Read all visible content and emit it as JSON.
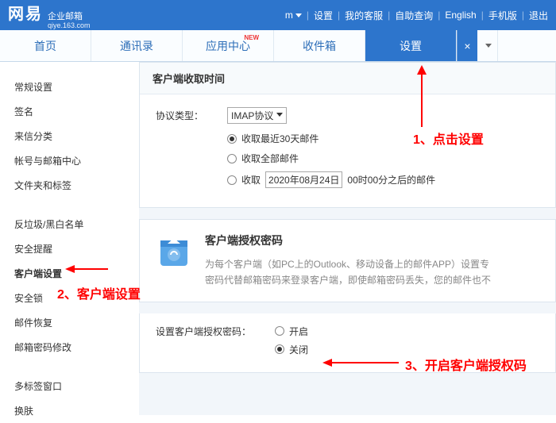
{
  "header": {
    "logo_main": "网易",
    "logo_sub": "企业邮箱",
    "logo_domain": "qiye.163.com",
    "user_suffix": "m",
    "links": {
      "settings": "设置",
      "service": "我的客服",
      "selfhelp": "自助查询",
      "english": "English",
      "mobile": "手机版",
      "logout": "退出"
    }
  },
  "tabs": {
    "home": "首页",
    "contacts": "通讯录",
    "apps": "应用中心",
    "apps_badge": "NEW",
    "inbox": "收件箱",
    "settings": "设置"
  },
  "sidebar": {
    "items": [
      "常规设置",
      "签名",
      "来信分类",
      "帐号与邮箱中心",
      "文件夹和标签",
      "反垃圾/黑白名单",
      "安全提醒",
      "客户端设置",
      "安全锁",
      "邮件恢复",
      "邮箱密码修改",
      "多标签窗口",
      "换肤"
    ]
  },
  "panel1": {
    "title": "客户端收取时间",
    "protocol_label": "协议类型：",
    "protocol_value": "IMAP协议",
    "opt_recent30": "收取最近30天邮件",
    "opt_all": "收取全部邮件",
    "opt_after_prefix": "收取",
    "opt_after_date": "2020年08月24日",
    "opt_after_suffix": "00时00分之后的邮件"
  },
  "panel2": {
    "title": "客户端授权密码",
    "desc1": "为每个客户端（如PC上的Outlook、移动设备上的邮件APP）设置专",
    "desc2": "密码代替邮箱密码来登录客户端，即使邮箱密码丢失，您的邮件也不",
    "set_label": "设置客户端授权密码：",
    "opt_on": "开启",
    "opt_off": "关闭"
  },
  "annotations": {
    "a1": "1、点击设置",
    "a2": "2、客户端设置",
    "a3": "3、开启客户端授权码"
  }
}
